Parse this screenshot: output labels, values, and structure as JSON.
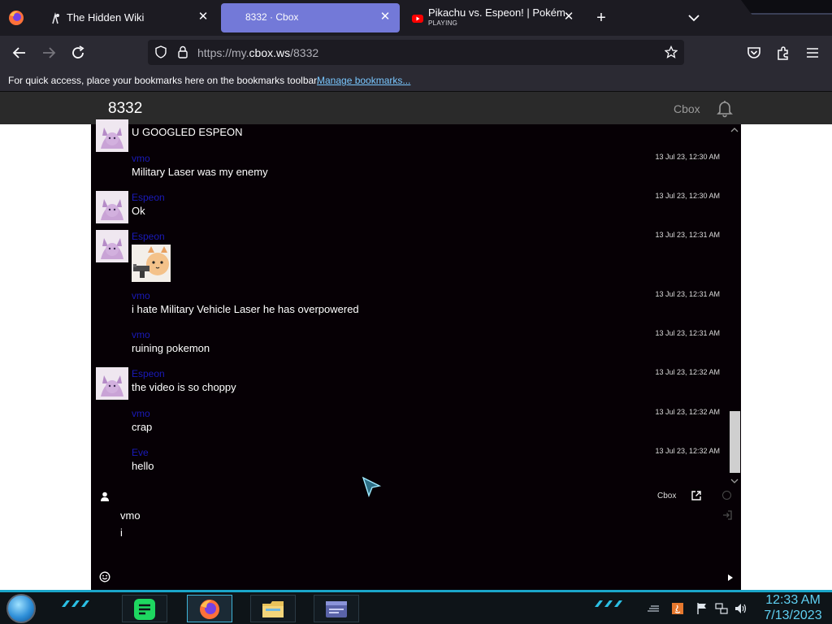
{
  "browser": {
    "tabs": [
      {
        "title": "The Hidden Wiki",
        "active": false
      },
      {
        "title": "8332 · Cbox",
        "active": true
      },
      {
        "title": "Pikachu vs. Espeon! | Pokémon",
        "subtitle": "PLAYING",
        "active": false
      }
    ],
    "url_prefix": "https://my.",
    "url_domain": "cbox.ws",
    "url_path": "/8332",
    "bookmarks_text": "For quick access, place your bookmarks here on the bookmarks toolbar.",
    "bookmarks_link": "Manage bookmarks..."
  },
  "page": {
    "title": "8332",
    "brand": "Cbox"
  },
  "chat": {
    "messages": [
      {
        "name": "",
        "text": "U GOOGLED ESPEON",
        "time": "",
        "avatar": true
      },
      {
        "name": "vmo",
        "text": "Military Laser was my enemy",
        "time": "13 Jul 23, 12:30 AM",
        "avatar": false
      },
      {
        "name": "Espeon",
        "text": "Ok",
        "time": "13 Jul 23, 12:30 AM",
        "avatar": true
      },
      {
        "name": "Espeon",
        "text": "",
        "time": "13 Jul 23, 12:31 AM",
        "avatar": true,
        "sticker": true
      },
      {
        "name": "vmo",
        "text": "i hate Military Vehicle Laser he has overpowered",
        "time": "13 Jul 23, 12:31 AM",
        "avatar": false
      },
      {
        "name": "vmo",
        "text": "ruining pokemon",
        "time": "13 Jul 23, 12:31 AM",
        "avatar": false
      },
      {
        "name": "Espeon",
        "text": "the video is so choppy",
        "time": "13 Jul 23, 12:32 AM",
        "avatar": true
      },
      {
        "name": "vmo",
        "text": "crap",
        "time": "13 Jul 23, 12:32 AM",
        "avatar": false
      },
      {
        "name": "Eve",
        "text": "hello",
        "time": "13 Jul 23, 12:32 AM",
        "avatar": false
      }
    ],
    "composer": {
      "brand": "Cbox",
      "username": "vmo",
      "draft": "i"
    }
  },
  "taskbar": {
    "time": "12:33 AM",
    "date": "7/13/2023"
  },
  "colors": {
    "active_tab": "#7379d8",
    "chat_bg": "#060005",
    "username": "#1a1ab8",
    "link": "#79c7ff",
    "taskbar_accent": "#1aa6c9"
  }
}
